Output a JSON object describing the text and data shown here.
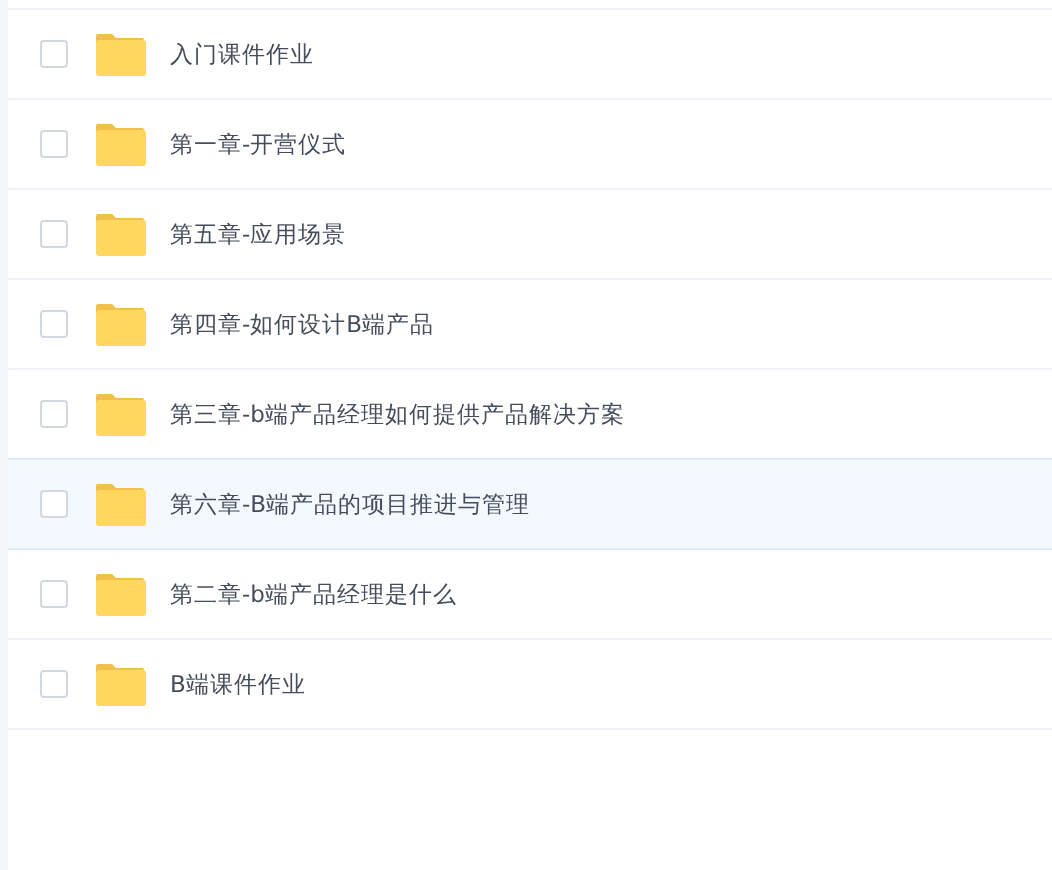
{
  "files": [
    {
      "name": "入门课件作业",
      "checked": false,
      "highlighted": false
    },
    {
      "name": "第一章-开营仪式",
      "checked": false,
      "highlighted": false
    },
    {
      "name": "第五章-应用场景",
      "checked": false,
      "highlighted": false
    },
    {
      "name": "第四章-如何设计B端产品",
      "checked": false,
      "highlighted": false
    },
    {
      "name": "第三章-b端产品经理如何提供产品解决方案",
      "checked": false,
      "highlighted": false
    },
    {
      "name": "第六章-B端产品的项目推进与管理",
      "checked": false,
      "highlighted": true
    },
    {
      "name": "第二章-b端产品经理是什么",
      "checked": false,
      "highlighted": false
    },
    {
      "name": "B端课件作业",
      "checked": false,
      "highlighted": false
    }
  ]
}
